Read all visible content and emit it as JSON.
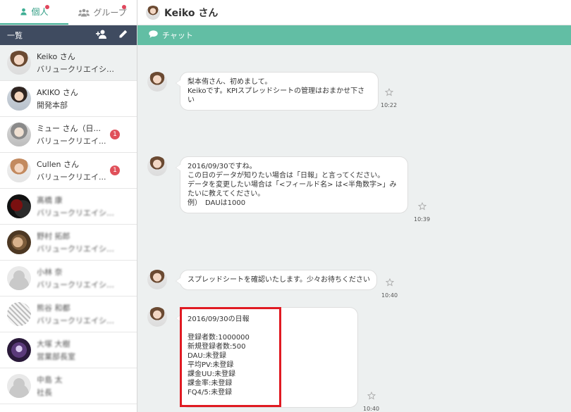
{
  "tabs": [
    {
      "label": "個人",
      "icon": "person-icon",
      "notification": true,
      "active": true
    },
    {
      "label": "グループ",
      "icon": "group-icon",
      "notification": true,
      "active": false
    }
  ],
  "list_header": {
    "title": "一覧",
    "add_icon": "add-user-icon",
    "edit_icon": "pencil-icon"
  },
  "contacts": [
    {
      "name": "Keiko さん",
      "sub": "バリュークリエイション...",
      "badge": ""
    },
    {
      "name": "AKIKO さん",
      "sub": "開発本部",
      "badge": ""
    },
    {
      "name": "ミュー さん（日...",
      "sub": "バリュークリエイ...",
      "badge": "1"
    },
    {
      "name": "Cullen さん",
      "sub": "バリュークリエイ...",
      "badge": "1"
    },
    {
      "name": "髙橋 康",
      "sub": "バリュークリエイション...",
      "badge": ""
    },
    {
      "name": "野村 拓郎",
      "sub": "バリュークリエイション...",
      "badge": ""
    },
    {
      "name": "小林 奈",
      "sub": "バリュークリエイション...",
      "badge": ""
    },
    {
      "name": "熊谷 和都",
      "sub": "バリュークリエイション...",
      "badge": ""
    },
    {
      "name": "大塚 大樹",
      "sub": "営業部長室",
      "badge": ""
    },
    {
      "name": "中島 太",
      "sub": "社長",
      "badge": ""
    }
  ],
  "chat": {
    "title": "Keiko さん",
    "section": "チャット",
    "section_icon": "chat-bubble-icon",
    "messages": [
      {
        "text": "梨本侑さん、初めまして。\nKeikoです。KPIスプレッドシートの管理はおまかせ下さい",
        "time": "10:22"
      },
      {
        "text": "2016/09/30ですね。\nこの日のデータが知りたい場合は「日報」と言ってください。\nデータを変更したい場合は「<フィールド名> は<半角数字>」み\nたいに教えてください。\n例）　DAUは1000",
        "time": "10:39"
      },
      {
        "text": "スプレッドシートを確認いたします。少々お待ちください",
        "time": "10:40"
      },
      {
        "text": "2016/09/30の日報\n\n登録者数:1000000\n新規登録者数:500\nDAU:未登録\n平均PV:未登録\n課金UU:未登録\n課金率:未登録\nFQ4/5:未登録",
        "time": "10:40"
      }
    ]
  },
  "colors": {
    "accent": "#62bea4",
    "header_dark": "#3f4b60",
    "badge": "#e0505a",
    "highlight": "#e01a22"
  }
}
